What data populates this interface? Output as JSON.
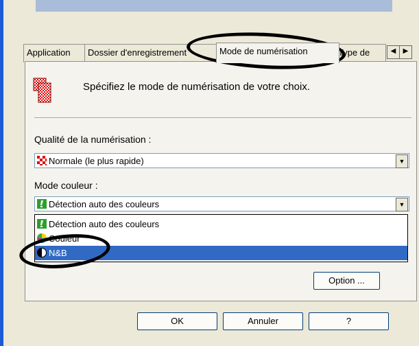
{
  "tabs": [
    {
      "label": "Application"
    },
    {
      "label": "Dossier d'enregistrement"
    },
    {
      "label": "Mode de numérisation"
    },
    {
      "label": "Type de"
    }
  ],
  "tab_scroll": {
    "left": "◀",
    "right": "▶"
  },
  "description": "Spécifiez le mode de numérisation de votre choix.",
  "quality": {
    "label": "Qualité de la numérisation :",
    "selected": "Normale (le plus rapide)"
  },
  "color_mode": {
    "label": "Mode couleur :",
    "selected": "Détection auto des couleurs",
    "options": [
      {
        "label": "Détection auto des couleurs",
        "icon": "auto-color-icon"
      },
      {
        "label": "Couleur",
        "icon": "color-wheel-icon"
      },
      {
        "label": "N&B",
        "icon": "black-white-icon",
        "selected": true
      }
    ]
  },
  "buttons": {
    "option": "Option ...",
    "ok": "OK",
    "cancel": "Annuler",
    "help": "?"
  },
  "colors": {
    "selection": "#316ac5",
    "window": "#ece9d8",
    "accent_bar": "#1b5bd6"
  }
}
